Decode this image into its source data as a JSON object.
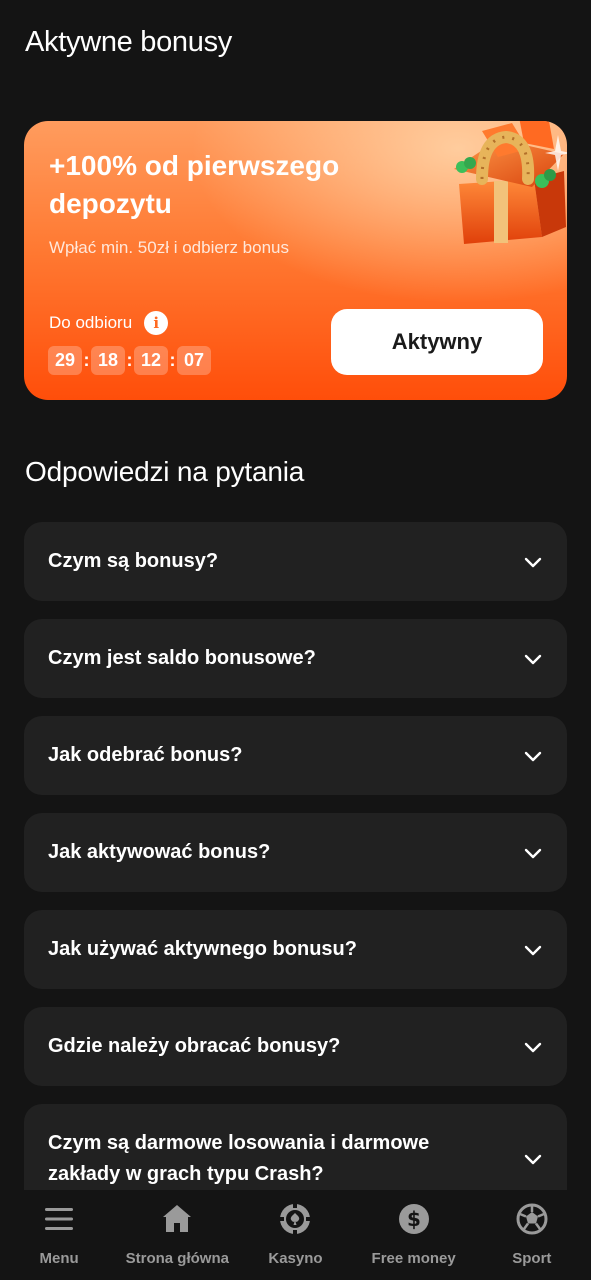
{
  "header": {
    "title": "Aktywne bonusy"
  },
  "promo": {
    "title": "+100% od pierwszego depozytu",
    "subtitle": "Wpłać min. 50zł i odbierz bonus",
    "claim_label": "Do odbioru",
    "timer": [
      "29",
      "18",
      "12",
      "07"
    ],
    "button_label": "Aktywny",
    "accent_color": "#ff5a14"
  },
  "faq": {
    "title": "Odpowiedzi na pytania",
    "items": [
      "Czym są bonusy?",
      "Czym jest saldo bonusowe?",
      "Jak odebrać bonus?",
      "Jak aktywować bonus?",
      "Jak używać aktywnego bonusu?",
      "Gdzie należy obracać bonusy?",
      "Czym są darmowe losowania i darmowe zakłady w grach typu Crash?"
    ]
  },
  "nav": {
    "items": [
      {
        "label": "Menu",
        "icon": "menu-icon"
      },
      {
        "label": "Strona główna",
        "icon": "home-icon"
      },
      {
        "label": "Kasyno",
        "icon": "casino-chip-icon"
      },
      {
        "label": "Free money",
        "icon": "dollar-coin-icon"
      },
      {
        "label": "Sport",
        "icon": "soccer-ball-icon"
      }
    ]
  }
}
